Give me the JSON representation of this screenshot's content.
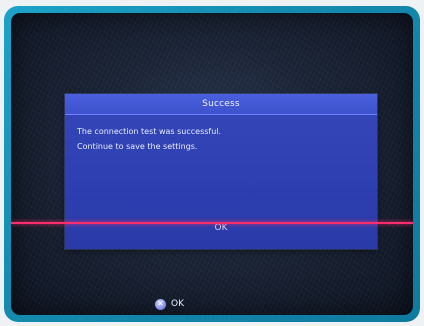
{
  "dialog": {
    "title": "Success",
    "lines": [
      "The connection test was successful.",
      "Continue to save the settings."
    ],
    "ok_label": "OK"
  },
  "hint": {
    "button_icon": "cross-button-icon",
    "glyph": "✕",
    "label": "OK"
  },
  "colors": {
    "frame": "#148bb0",
    "dialog": "#2d3fb1",
    "title_bar": "#3d52cc",
    "highlight": "#ff2d6c"
  }
}
